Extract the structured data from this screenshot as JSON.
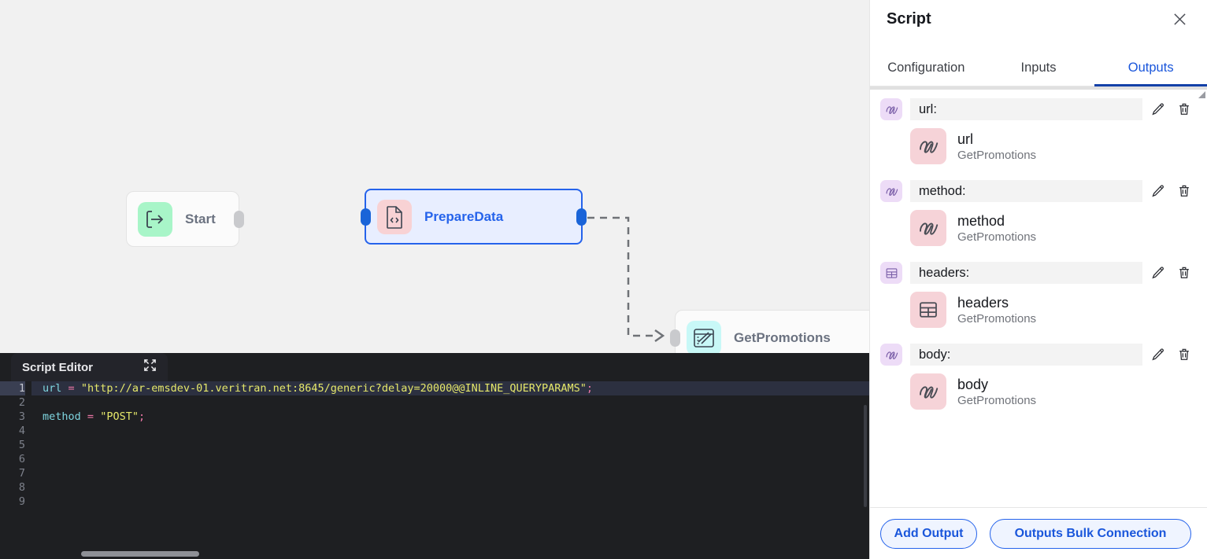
{
  "canvas": {
    "background_color": "#f1f1f1",
    "nodes": [
      {
        "id": "start",
        "label": "Start",
        "icon": "start-arrow-icon",
        "icon_bg": "#a8f5c8",
        "selected": false
      },
      {
        "id": "prepare_data",
        "label": "PrepareData",
        "icon": "script-file-icon",
        "icon_bg": "#f8d2d4",
        "selected": true,
        "selection_color": "#2563eb"
      },
      {
        "id": "get_promotions",
        "label": "GetPromotions",
        "icon": "browser-window-icon",
        "icon_bg": "#c8f8f7",
        "selected": false
      }
    ],
    "edges": [
      {
        "from": "prepare_data",
        "to": "get_promotions",
        "style": "dashed",
        "color": "#6f7277"
      }
    ]
  },
  "editor": {
    "tab_title": "Script Editor",
    "collapse_icon": "collapse-inward-icon",
    "active_line": 1,
    "line_numbers": [
      "1",
      "2",
      "3",
      "4",
      "5",
      "6",
      "7",
      "8",
      "9"
    ],
    "lines": [
      {
        "n": "1",
        "tokens": [
          {
            "t": "url",
            "c": "var"
          },
          {
            "t": " ",
            "c": "pun"
          },
          {
            "t": "=",
            "c": "op"
          },
          {
            "t": " ",
            "c": "pun"
          },
          {
            "t": "\"http://ar-emsdev-01.veritran.net:8645/generic?delay=20000@@INLINE_QUERYPARAMS\"",
            "c": "str"
          },
          {
            "t": ";",
            "c": "op"
          }
        ]
      },
      {
        "n": "2",
        "tokens": []
      },
      {
        "n": "3",
        "tokens": [
          {
            "t": "method",
            "c": "var"
          },
          {
            "t": " ",
            "c": "pun"
          },
          {
            "t": "=",
            "c": "op"
          },
          {
            "t": " ",
            "c": "pun"
          },
          {
            "t": "\"POST\"",
            "c": "str"
          },
          {
            "t": ";",
            "c": "op"
          }
        ]
      },
      {
        "n": "4",
        "tokens": []
      },
      {
        "n": "5",
        "tokens": []
      },
      {
        "n": "6",
        "tokens": []
      },
      {
        "n": "7",
        "tokens": []
      },
      {
        "n": "8",
        "tokens": []
      },
      {
        "n": "9",
        "tokens": []
      }
    ],
    "code_plain": "url = \"http://ar-emsdev-01.veritran.net:8645/generic?delay=20000@@INLINE_QUERYPARAMS\";\n\nmethod = \"POST\";\n",
    "theme": {
      "background": "#1e1f22",
      "active_line": "#2c3040",
      "variable": "#7fd6e0",
      "operator": "#f078a8",
      "string": "#e6e86a",
      "gutter_text": "#7e828c"
    }
  },
  "panel": {
    "title": "Script",
    "close_icon": "close-icon",
    "resize_icon": "resize-handle-icon",
    "tabs": [
      {
        "label": "Configuration",
        "active": false
      },
      {
        "label": "Inputs",
        "active": false
      },
      {
        "label": "Outputs",
        "active": true
      }
    ],
    "accent_color": "#1a56db",
    "outputs": [
      {
        "name": "url:",
        "type_icon": "string-squiggle-icon",
        "edit_icon": "pencil-icon",
        "delete_icon": "trash-icon",
        "link": {
          "title": "url",
          "subtitle": "GetPromotions",
          "type_icon": "string-squiggle-icon"
        }
      },
      {
        "name": "method:",
        "type_icon": "string-squiggle-icon",
        "edit_icon": "pencil-icon",
        "delete_icon": "trash-icon",
        "link": {
          "title": "method",
          "subtitle": "GetPromotions",
          "type_icon": "string-squiggle-icon"
        }
      },
      {
        "name": "headers:",
        "type_icon": "table-grid-icon",
        "edit_icon": "pencil-icon",
        "delete_icon": "trash-icon",
        "link": {
          "title": "headers",
          "subtitle": "GetPromotions",
          "type_icon": "table-grid-icon"
        }
      },
      {
        "name": "body:",
        "type_icon": "string-squiggle-icon",
        "edit_icon": "pencil-icon",
        "delete_icon": "trash-icon",
        "link": {
          "title": "body",
          "subtitle": "GetPromotions",
          "type_icon": "string-squiggle-icon"
        }
      }
    ],
    "footer": {
      "add_output_label": "Add Output",
      "bulk_connection_label": "Outputs Bulk Connection"
    }
  }
}
